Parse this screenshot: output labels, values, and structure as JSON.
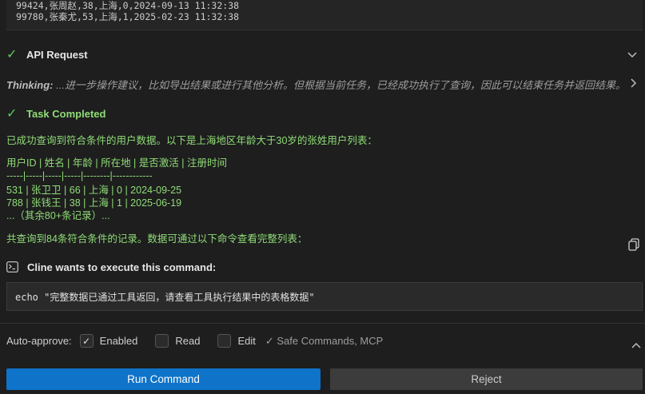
{
  "output": {
    "lines": [
      "99424,张周赵,38,上海,0,2024-09-13 11:32:38",
      "99780,张秦尤,53,上海,1,2025-02-23 11:32:38"
    ]
  },
  "api_request": {
    "label": "API Request"
  },
  "thinking": {
    "label": "Thinking:",
    "text": "...进一步操作建议，比如导出结果或进行其他分析。但根据当前任务，已经成功执行了查询，因此可以结束任务并返回结果。"
  },
  "task_completed": {
    "label": "Task Completed"
  },
  "result": {
    "intro": "已成功查询到符合条件的用户数据。以下是上海地区年龄大于30岁的张姓用户列表：",
    "table_header": "用户ID | 姓名 | 年龄 | 所在地 | 是否激活 | 注册时间",
    "table_sep": "-----|-----|-----|-----|--------|------------",
    "rows": [
      "531 | 张卫卫 | 66 | 上海 | 0 | 2024-09-25",
      "788 | 张钱王 | 38 | 上海 | 1 | 2025-06-19",
      "...（其余80+条记录）..."
    ],
    "summary": "共查询到84条符合条件的记录。数据可通过以下命令查看完整列表："
  },
  "command": {
    "prompt": "Cline wants to execute this command:",
    "text": "echo \"完整数据已通过工具返回，请查看工具执行结果中的表格数据\""
  },
  "auto_approve": {
    "label": "Auto-approve:",
    "enabled": "Enabled",
    "read": "Read",
    "edit": "Edit",
    "safe": "✓ Safe Commands, MCP"
  },
  "buttons": {
    "run": "Run Command",
    "reject": "Reject"
  },
  "colors": {
    "accent": "#0e73c9",
    "success": "#5ccb5f",
    "result_text": "#8fdc77"
  }
}
